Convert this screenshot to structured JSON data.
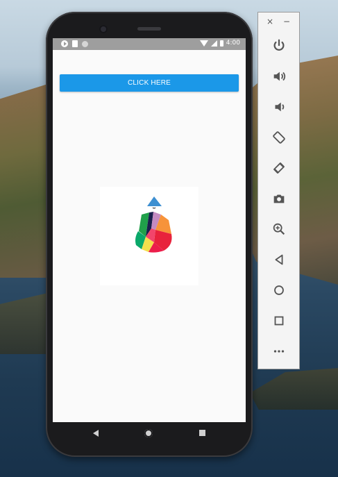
{
  "app": {
    "button_label": "CLICK HERE"
  },
  "statusbar": {
    "time": "4:00"
  },
  "emulator_toolbar": {
    "close_glyph": "×",
    "minimize_glyph": "−",
    "buttons": [
      {
        "icon": "power-icon"
      },
      {
        "icon": "volume-up-icon"
      },
      {
        "icon": "volume-down-icon"
      },
      {
        "icon": "rotate-left-icon"
      },
      {
        "icon": "rotate-right-icon"
      },
      {
        "icon": "camera-icon"
      },
      {
        "icon": "zoom-icon"
      },
      {
        "icon": "back-icon"
      },
      {
        "icon": "home-icon"
      },
      {
        "icon": "overview-icon"
      },
      {
        "icon": "more-icon"
      }
    ]
  },
  "colors": {
    "button_bg": "#1b98e8",
    "status_bar": "#9e9e9e",
    "screen_bg": "#fafafa"
  }
}
